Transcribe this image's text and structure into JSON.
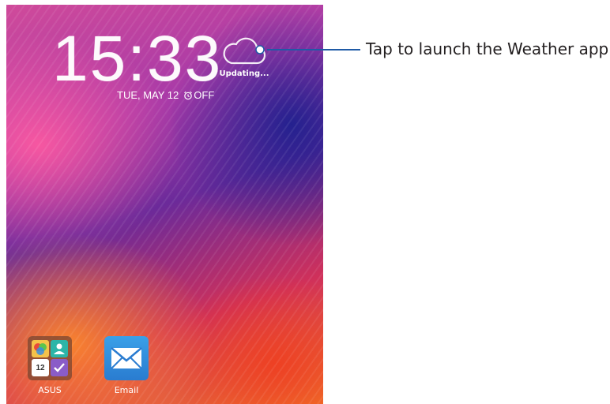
{
  "lockscreen": {
    "time": "15:33",
    "date": "TUE, MAY 12",
    "alarm_status": "OFF",
    "weather_status": "Updating..."
  },
  "apps": [
    {
      "label": "ASUS",
      "icon": "asus-folder-icon",
      "calendar_day": "12"
    },
    {
      "label": "Email",
      "icon": "email-envelope-icon"
    }
  ],
  "callout": {
    "text": "Tap to launch the Weather app",
    "line_color": "#1f5aa6"
  }
}
